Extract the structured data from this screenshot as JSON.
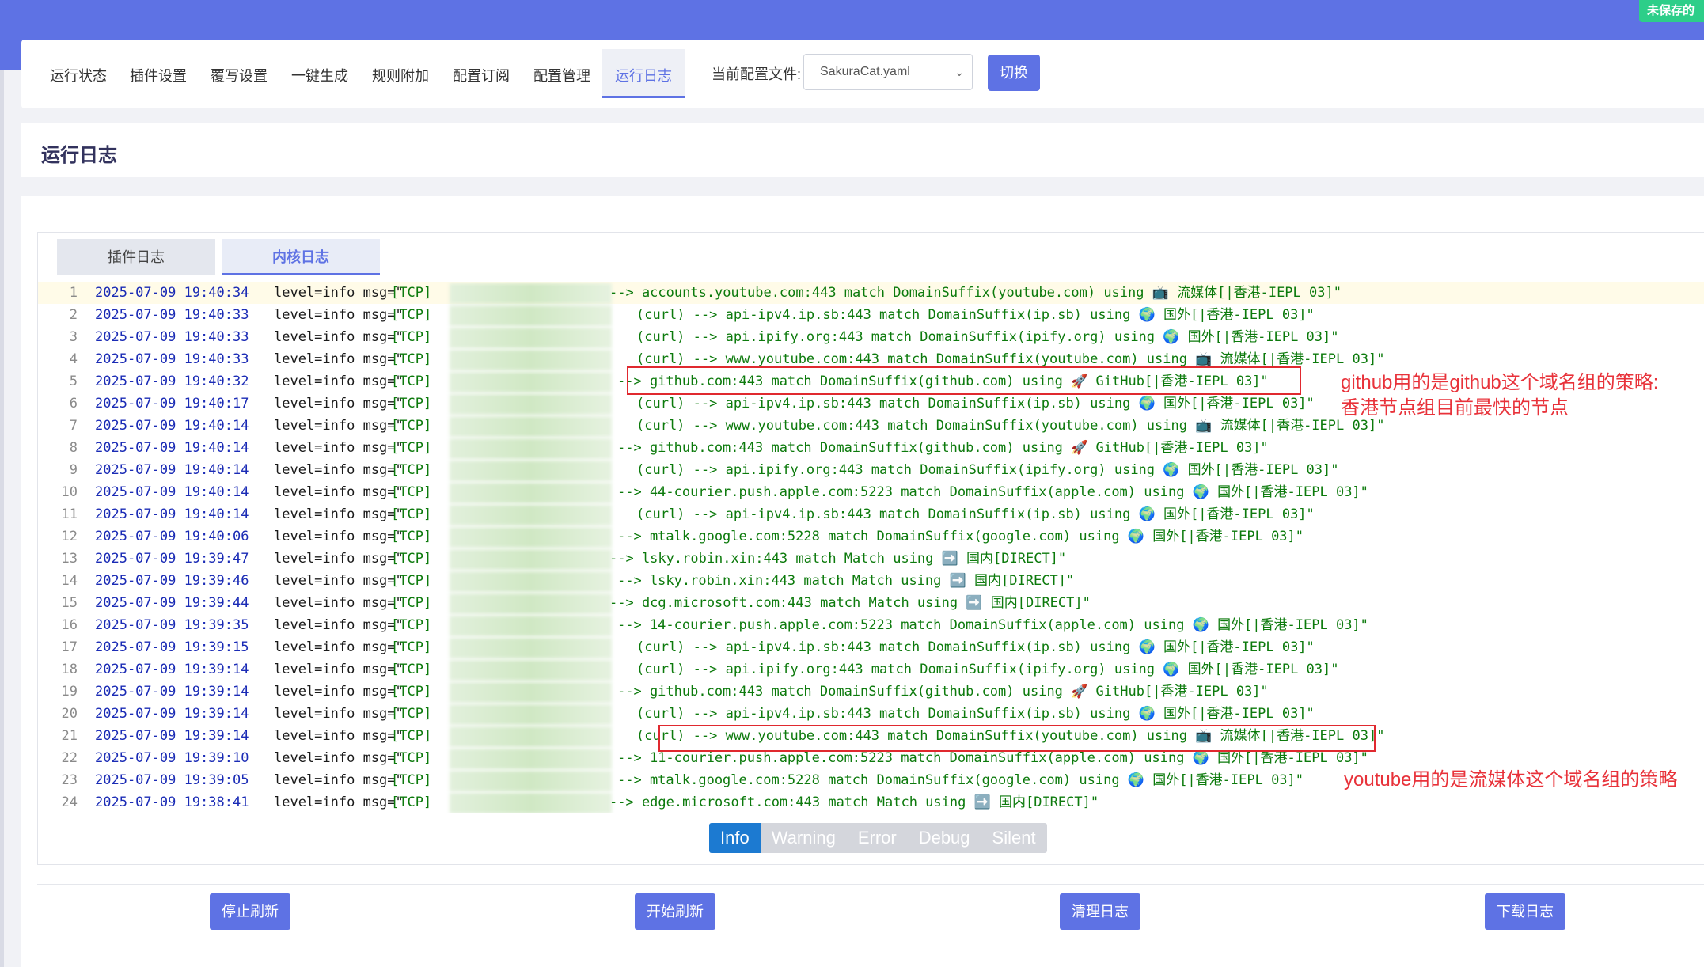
{
  "top_bar": {
    "unsaved_badge": "未保存的"
  },
  "nav": {
    "tabs": [
      "运行状态",
      "插件设置",
      "覆写设置",
      "一键生成",
      "规则附加",
      "配置订阅",
      "配置管理",
      "运行日志"
    ],
    "active_tab": "运行日志",
    "config_label": "当前配置文件:",
    "config_value": "SakuraCat.yaml",
    "switch_button": "切换"
  },
  "page_title": "运行日志",
  "log_tabs": [
    "插件日志",
    "内核日志"
  ],
  "active_log_tab": "内核日志",
  "log_lines": [
    {
      "n": "1",
      "time": "2025-07-09 19:40:34",
      "level": "level=info msg=\"",
      "tag": "[TCP]",
      "rest": "--> accounts.youtube.com:443 match DomainSuffix(youtube.com) using 📺 流媒体[|香港-IEPL 03]\""
    },
    {
      "n": "2",
      "time": "2025-07-09 19:40:33",
      "level": "level=info msg=\"",
      "tag": "[TCP]",
      "rest": "(curl) --> api-ipv4.ip.sb:443 match DomainSuffix(ip.sb) using 🌍 国外[|香港-IEPL 03]\""
    },
    {
      "n": "3",
      "time": "2025-07-09 19:40:33",
      "level": "level=info msg=\"",
      "tag": "[TCP]",
      "rest": "(curl) --> api.ipify.org:443 match DomainSuffix(ipify.org) using 🌍 国外[|香港-IEPL 03]\""
    },
    {
      "n": "4",
      "time": "2025-07-09 19:40:33",
      "level": "level=info msg=\"",
      "tag": "[TCP]",
      "rest": "(curl) --> www.youtube.com:443 match DomainSuffix(youtube.com) using 📺 流媒体[|香港-IEPL 03]\""
    },
    {
      "n": "5",
      "time": "2025-07-09 19:40:32",
      "level": "level=info msg=\"",
      "tag": "[TCP]",
      "rest": "--> github.com:443 match DomainSuffix(github.com) using 🚀 GitHub[|香港-IEPL 03]\""
    },
    {
      "n": "6",
      "time": "2025-07-09 19:40:17",
      "level": "level=info msg=\"",
      "tag": "[TCP]",
      "rest": "(curl) --> api-ipv4.ip.sb:443 match DomainSuffix(ip.sb) using 🌍 国外[|香港-IEPL 03]\""
    },
    {
      "n": "7",
      "time": "2025-07-09 19:40:14",
      "level": "level=info msg=\"",
      "tag": "[TCP]",
      "rest": "(curl) --> www.youtube.com:443 match DomainSuffix(youtube.com) using 📺 流媒体[|香港-IEPL 03]\""
    },
    {
      "n": "8",
      "time": "2025-07-09 19:40:14",
      "level": "level=info msg=\"",
      "tag": "[TCP]",
      "rest": "--> github.com:443 match DomainSuffix(github.com) using 🚀 GitHub[|香港-IEPL 03]\""
    },
    {
      "n": "9",
      "time": "2025-07-09 19:40:14",
      "level": "level=info msg=\"",
      "tag": "[TCP]",
      "rest": "(curl) --> api.ipify.org:443 match DomainSuffix(ipify.org) using 🌍 国外[|香港-IEPL 03]\""
    },
    {
      "n": "10",
      "time": "2025-07-09 19:40:14",
      "level": "level=info msg=\"",
      "tag": "[TCP]",
      "rest": "--> 44-courier.push.apple.com:5223 match DomainSuffix(apple.com) using 🌍 国外[|香港-IEPL 03]\""
    },
    {
      "n": "11",
      "time": "2025-07-09 19:40:14",
      "level": "level=info msg=\"",
      "tag": "[TCP]",
      "rest": "(curl) --> api-ipv4.ip.sb:443 match DomainSuffix(ip.sb) using 🌍 国外[|香港-IEPL 03]\""
    },
    {
      "n": "12",
      "time": "2025-07-09 19:40:06",
      "level": "level=info msg=\"",
      "tag": "[TCP]",
      "rest": "--> mtalk.google.com:5228 match DomainSuffix(google.com) using 🌍 国外[|香港-IEPL 03]\""
    },
    {
      "n": "13",
      "time": "2025-07-09 19:39:47",
      "level": "level=info msg=\"",
      "tag": "[TCP]",
      "rest": "--> lsky.robin.xin:443 match Match using ➡️ 国内[DIRECT]\""
    },
    {
      "n": "14",
      "time": "2025-07-09 19:39:46",
      "level": "level=info msg=\"",
      "tag": "[TCP]",
      "rest": "--> lsky.robin.xin:443 match Match using ➡️ 国内[DIRECT]\""
    },
    {
      "n": "15",
      "time": "2025-07-09 19:39:44",
      "level": "level=info msg=\"",
      "tag": "[TCP]",
      "rest": "--> dcg.microsoft.com:443 match Match using ➡️ 国内[DIRECT]\""
    },
    {
      "n": "16",
      "time": "2025-07-09 19:39:35",
      "level": "level=info msg=\"",
      "tag": "[TCP]",
      "rest": "--> 14-courier.push.apple.com:5223 match DomainSuffix(apple.com) using 🌍 国外[|香港-IEPL 03]\""
    },
    {
      "n": "17",
      "time": "2025-07-09 19:39:15",
      "level": "level=info msg=\"",
      "tag": "[TCP]",
      "rest": "(curl) --> api-ipv4.ip.sb:443 match DomainSuffix(ip.sb) using 🌍 国外[|香港-IEPL 03]\""
    },
    {
      "n": "18",
      "time": "2025-07-09 19:39:14",
      "level": "level=info msg=\"",
      "tag": "[TCP]",
      "rest": "(curl) --> api.ipify.org:443 match DomainSuffix(ipify.org) using 🌍 国外[|香港-IEPL 03]\""
    },
    {
      "n": "19",
      "time": "2025-07-09 19:39:14",
      "level": "level=info msg=\"",
      "tag": "[TCP]",
      "rest": "--> github.com:443 match DomainSuffix(github.com) using 🚀 GitHub[|香港-IEPL 03]\""
    },
    {
      "n": "20",
      "time": "2025-07-09 19:39:14",
      "level": "level=info msg=\"",
      "tag": "[TCP]",
      "rest": "(curl) --> api-ipv4.ip.sb:443 match DomainSuffix(ip.sb) using 🌍 国外[|香港-IEPL 03]\""
    },
    {
      "n": "21",
      "time": "2025-07-09 19:39:14",
      "level": "level=info msg=\"",
      "tag": "[TCP]",
      "rest": "(curl) --> www.youtube.com:443 match DomainSuffix(youtube.com) using 📺 流媒体[|香港-IEPL 03]\""
    },
    {
      "n": "22",
      "time": "2025-07-09 19:39:10",
      "level": "level=info msg=\"",
      "tag": "[TCP]",
      "rest": "--> 11-courier.push.apple.com:5223 match DomainSuffix(apple.com) using 🌍 国外[|香港-IEPL 03]\""
    },
    {
      "n": "23",
      "time": "2025-07-09 19:39:05",
      "level": "level=info msg=\"",
      "tag": "[TCP]",
      "rest": "--> mtalk.google.com:5228 match DomainSuffix(google.com) using 🌍 国外[|香港-IEPL 03]\""
    },
    {
      "n": "24",
      "time": "2025-07-09 19:38:41",
      "level": "level=info msg=\"",
      "tag": "[TCP]",
      "rest": "--> edge.microsoft.com:443 match Match using ➡️ 国内[DIRECT]\""
    }
  ],
  "annotations": {
    "github_line1": "github用的是github这个域名组的策略:",
    "github_line2": "香港节点组目前最快的节点",
    "youtube": "youtube用的是流媒体这个域名组的策略"
  },
  "levels": [
    "Info",
    "Warning",
    "Error",
    "Debug",
    "Silent"
  ],
  "active_level": "Info",
  "buttons": {
    "stop": "停止刷新",
    "start": "开始刷新",
    "clear": "清理日志",
    "download": "下载日志"
  },
  "colors": {
    "accent": "#5e72e4",
    "badge": "#2dce89",
    "level_active": "#1c7ad1",
    "annotation": "#e8323a",
    "log_green": "#0c7a0c",
    "log_blue": "#1a2bb5"
  }
}
